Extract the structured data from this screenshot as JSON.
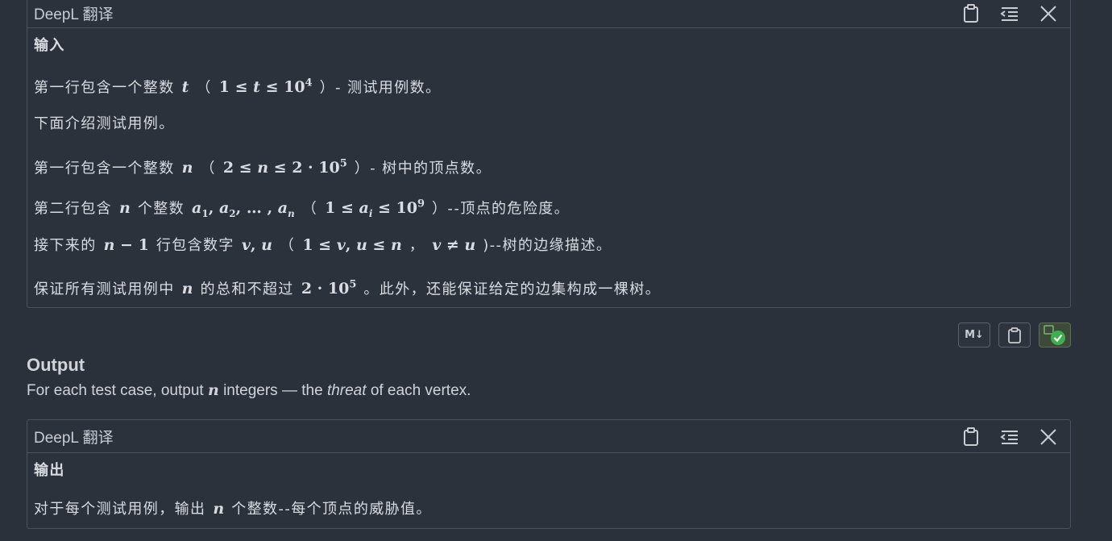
{
  "panel1": {
    "title": "DeepL 翻译",
    "heading": "输入",
    "line1": {
      "a": "第一行包含一个整数",
      "b": "（",
      "c": "）- 测试用例数。"
    },
    "line2": "下面介绍测试用例。",
    "line3": {
      "a": "第一行包含一个整数",
      "b": "（",
      "c": "）- 树中的顶点数。"
    },
    "line4": {
      "a": "第二行包含",
      "b": "个整数",
      "c": "（",
      "d": "）--顶点的危险度。"
    },
    "line5": {
      "a": "接下来的",
      "b": "行包含数字",
      "c": "（",
      "d": "，",
      "e": ")--树的边缘描述。"
    },
    "line6": {
      "a": "保证所有测试用例中",
      "b": "的总和不超过",
      "c": "。此外，还能保证给定的边集构成一棵树。"
    }
  },
  "toolbar": {
    "md_label": "M↓"
  },
  "output": {
    "title": "Output",
    "text_a": "For each test case, output",
    "var_n": "n",
    "text_b": "integers — the",
    "text_em": "threat",
    "text_c": "of each vertex."
  },
  "panel2": {
    "title": "DeepL 翻译",
    "heading": "输出",
    "line1": {
      "a": "对于每个测试用例，输出",
      "b": "个整数--每个顶点的威胁值。"
    }
  },
  "icons": [
    "clipboard-icon",
    "indent-icon",
    "close-icon",
    "markdown-icon",
    "translate-check-icon"
  ],
  "colors": {
    "background": "#2b313b",
    "border": "#4a5260",
    "text": "#d9dce1",
    "check_green": "#3fae4f"
  }
}
